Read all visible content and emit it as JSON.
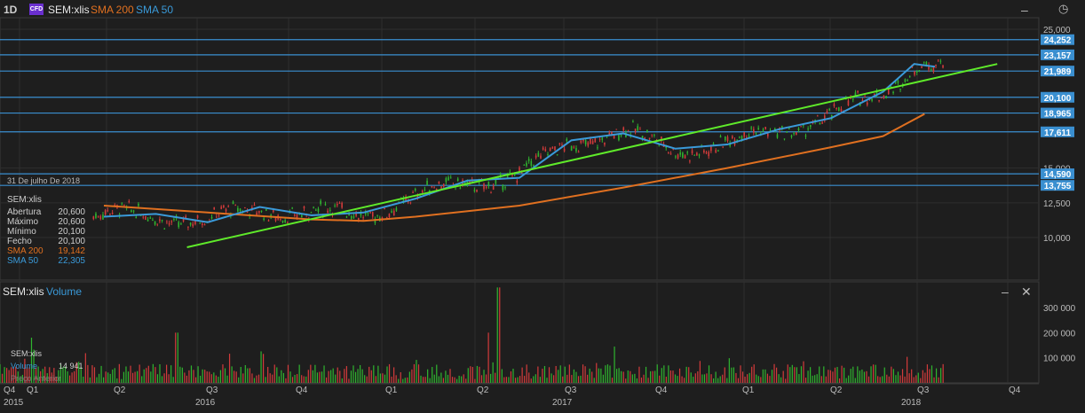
{
  "header": {
    "interval": "1D",
    "badge": "CFD",
    "symbol": "SEM:xlis",
    "sma200_label": "SMA 200",
    "sma50_label": "SMA 50"
  },
  "tooltip": {
    "date": "31 De julho De 2018",
    "title": "SEM:xlis",
    "rows": [
      {
        "label": "Abertura",
        "value": "20,600"
      },
      {
        "label": "Máximo",
        "value": "20,600"
      },
      {
        "label": "Mínimo",
        "value": "20,100"
      },
      {
        "label": "Fecho",
        "value": "20,100"
      },
      {
        "label": "SMA 200",
        "value": "19,142"
      },
      {
        "label": "SMA 50",
        "value": "22,305"
      }
    ]
  },
  "volume_panel": {
    "symbol": "SEM:xlis",
    "label": "Volume",
    "legend_label": "Volume",
    "legend_value": "14 941",
    "covered_text": "Preço Anterior"
  },
  "colors": {
    "background": "#1e1e1e",
    "grid": "#2f2f2f",
    "up": "#2fb52f",
    "down": "#d23b3b",
    "sma200": "#e07020",
    "sma50": "#3a9ad9",
    "trendline": "#5fea2a",
    "hline": "#3a8fd0"
  },
  "chart_data": [
    {
      "type": "line",
      "title": "",
      "y_axis_ticks": [
        "25,000",
        "15,000",
        "12,500",
        "10,000"
      ],
      "price_levels": [
        "24,252",
        "23,157",
        "21,989",
        "20,100",
        "18,965",
        "17,611",
        "14,590",
        "13,755"
      ],
      "x_quarter_labels": [
        "Q4",
        "Q1",
        "Q2",
        "Q3",
        "Q4",
        "Q1",
        "Q2",
        "Q3",
        "Q4",
        "Q1",
        "Q2",
        "Q3",
        "Q4"
      ],
      "x_year_labels": [
        "2015",
        "2016",
        "2017",
        "2018"
      ],
      "series": [
        {
          "name": "SMA 200",
          "x": [
            0.1,
            0.2,
            0.3,
            0.35,
            0.4,
            0.5,
            0.6,
            0.7,
            0.8,
            0.85,
            0.89
          ],
          "y": [
            12300,
            11800,
            11300,
            11200,
            11500,
            12300,
            13600,
            15000,
            16500,
            17300,
            18900
          ]
        },
        {
          "name": "SMA 50",
          "x": [
            0.1,
            0.15,
            0.2,
            0.25,
            0.3,
            0.35,
            0.4,
            0.45,
            0.5,
            0.55,
            0.6,
            0.65,
            0.7,
            0.75,
            0.8,
            0.85,
            0.88,
            0.9
          ],
          "y": [
            11500,
            11700,
            11100,
            12200,
            11600,
            11800,
            12800,
            14100,
            14300,
            17000,
            17500,
            16400,
            16700,
            17800,
            18600,
            20500,
            22500,
            22300
          ]
        },
        {
          "name": "Trendline",
          "x": [
            0.18,
            0.96
          ],
          "y": [
            9300,
            22500
          ]
        }
      ]
    },
    {
      "type": "bar",
      "title": "",
      "y_axis_ticks": [
        "300 000",
        "200 000",
        "100 000"
      ],
      "peaks": [
        {
          "x": 0.48,
          "value": 380000
        },
        {
          "x": 0.47,
          "value": 200000
        },
        {
          "x": 0.03,
          "value": 180000
        },
        {
          "x": 0.17,
          "value": 200000
        }
      ]
    }
  ]
}
